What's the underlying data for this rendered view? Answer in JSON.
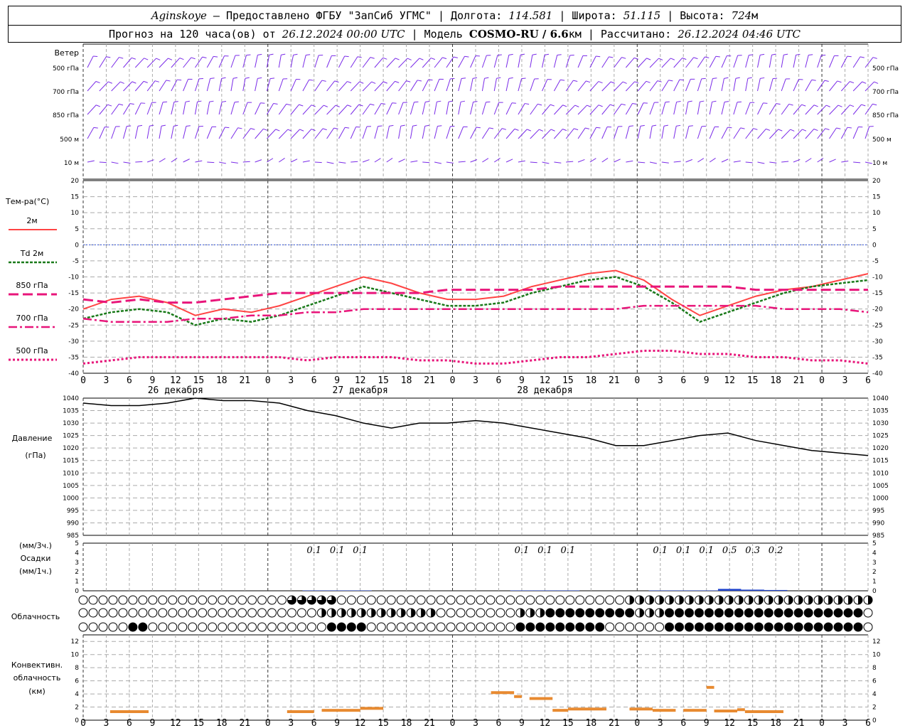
{
  "header": {
    "station": "Aginskoye",
    "provider": " – Предоставлено ФГБУ \"ЗапСиб УГМС\" | Долгота: ",
    "lon": "114.581",
    "lat_label": " | Широта: ",
    "lat": "51.115",
    "alt_label": " | Высота: ",
    "alt": "724",
    "alt_unit": "м",
    "forecast_label": "Прогноз на 120 часа(ов) от ",
    "forecast_start": "26.12.2024 00:00 UTC",
    "model_label": " | Модель ",
    "model": "COSMO-RU / 6.6",
    "model_unit": "км",
    "calc_label": " | Рассчитано: ",
    "calc_time": "26.12.2024 04:46 UTC"
  },
  "panels": {
    "wind": {
      "title": "Ветер",
      "levels": [
        "500 гПа",
        "700 гПа",
        "850 гПа",
        "500 м",
        "10 м"
      ]
    },
    "temperature": {
      "title": "Тем-ра(°C)",
      "legend": [
        {
          "label": "2м",
          "color": "#ff4444"
        },
        {
          "label": "Td 2м",
          "color": "#1a7a1a"
        },
        {
          "label": "850 гПа",
          "color": "#e8157a"
        },
        {
          "label": "700 гПа",
          "color": "#e8157a"
        },
        {
          "label": "500 гПа",
          "color": "#e8157a"
        }
      ]
    },
    "pressure": {
      "title": "Давление",
      "unit": "(гПа)"
    },
    "precip": {
      "unit_3h": "(мм/3ч.)",
      "title": "Осадки",
      "unit_1h": "(мм/1ч.)"
    },
    "clouds": {
      "title": "Облачность"
    },
    "convective": {
      "title_1": "Конвективн.",
      "title_2": "облачность",
      "unit": "(км)"
    }
  },
  "dates": [
    "26 декабря",
    "27 декабря",
    "28 декабря"
  ],
  "colors": {
    "wind": "#7a2be8",
    "t2m": "#ff4444",
    "td": "#1a7a1a",
    "upper": "#e8157a",
    "zero": "#3355dd",
    "precip": "#2244cc",
    "conv": "#e88a30"
  },
  "chart_data": {
    "type": "line",
    "x_hours": [
      0,
      3,
      6,
      9,
      12,
      15,
      18,
      21,
      24,
      27,
      30,
      33,
      36,
      39,
      42,
      45,
      48,
      51,
      54,
      57,
      60,
      63,
      66,
      69,
      72,
      75,
      78,
      81,
      84,
      87,
      90,
      93,
      96,
      99,
      102
    ],
    "x_tick_labels": [
      "0",
      "3",
      "6",
      "9",
      "12",
      "15",
      "18",
      "21",
      "0",
      "3",
      "6",
      "9",
      "12",
      "15",
      "18",
      "21",
      "0",
      "3",
      "6",
      "9",
      "12",
      "15",
      "18",
      "21",
      "0",
      "3",
      "6",
      "9",
      "12",
      "15",
      "18",
      "21",
      "0",
      "3",
      "6"
    ],
    "temperature": {
      "ylim": [
        -40,
        20
      ],
      "ticks": [
        20,
        15,
        10,
        5,
        0,
        -5,
        -10,
        -15,
        -20,
        -25,
        -30,
        -35,
        -40
      ],
      "series": [
        {
          "name": "2м",
          "values": [
            -20,
            -17,
            -16,
            -18,
            -22,
            -20,
            -21,
            -19,
            -16,
            -13,
            -10,
            -12,
            -15,
            -17,
            -17,
            -16,
            -13,
            -11,
            -9,
            -8,
            -11,
            -17,
            -22,
            -19,
            -16,
            -14,
            -13,
            -11,
            -9
          ]
        },
        {
          "name": "Td 2м",
          "values": [
            -23,
            -21,
            -20,
            -21,
            -25,
            -23,
            -24,
            -22,
            -19,
            -16,
            -13,
            -15,
            -17,
            -19,
            -19,
            -18,
            -15,
            -13,
            -11,
            -10,
            -13,
            -18,
            -24,
            -21,
            -18,
            -15,
            -13,
            -12,
            -11
          ]
        },
        {
          "name": "850 гПа",
          "values": [
            -17,
            -18,
            -17,
            -18,
            -18,
            -17,
            -16,
            -15,
            -15,
            -15,
            -15,
            -15,
            -15,
            -14,
            -14,
            -14,
            -14,
            -13,
            -13,
            -13,
            -13,
            -13,
            -13,
            -13,
            -14,
            -14,
            -14,
            -14,
            -14
          ]
        },
        {
          "name": "700 гПа",
          "values": [
            -23,
            -24,
            -24,
            -24,
            -23,
            -23,
            -22,
            -22,
            -21,
            -21,
            -20,
            -20,
            -20,
            -20,
            -20,
            -20,
            -20,
            -20,
            -20,
            -20,
            -19,
            -19,
            -19,
            -19,
            -19,
            -20,
            -20,
            -20,
            -21
          ]
        },
        {
          "name": "500 гПа",
          "values": [
            -37,
            -36,
            -35,
            -35,
            -35,
            -35,
            -35,
            -35,
            -36,
            -35,
            -35,
            -35,
            -36,
            -36,
            -37,
            -37,
            -36,
            -35,
            -35,
            -34,
            -33,
            -33,
            -34,
            -34,
            -35,
            -35,
            -36,
            -36,
            -37
          ]
        }
      ]
    },
    "pressure": {
      "ylim": [
        985,
        1040
      ],
      "ticks": [
        1040,
        1035,
        1030,
        1025,
        1020,
        1015,
        1010,
        1005,
        1000,
        995,
        990,
        985
      ],
      "values": [
        1038,
        1037,
        1037,
        1038,
        1040,
        1039,
        1039,
        1038,
        1035,
        1033,
        1030,
        1028,
        1030,
        1030,
        1031,
        1030,
        1028,
        1026,
        1024,
        1021,
        1021,
        1023,
        1025,
        1026,
        1023,
        1021,
        1019,
        1018,
        1017
      ]
    },
    "precipitation": {
      "ylim": [
        0,
        5
      ],
      "ticks": [
        5,
        4,
        3,
        2,
        1,
        0
      ],
      "totals_3h": [
        {
          "hour": 30,
          "value": "0.1"
        },
        {
          "hour": 33,
          "value": "0.1"
        },
        {
          "hour": 36,
          "value": "0.1"
        },
        {
          "hour": 57,
          "value": "0.1"
        },
        {
          "hour": 60,
          "value": "0.1"
        },
        {
          "hour": 63,
          "value": "0.1"
        },
        {
          "hour": 75,
          "value": "0.1"
        },
        {
          "hour": 78,
          "value": "0.1"
        },
        {
          "hour": 81,
          "value": "0.1"
        },
        {
          "hour": 84,
          "value": "0.5"
        },
        {
          "hour": 87,
          "value": "0.3"
        },
        {
          "hour": 90,
          "value": "0.2"
        }
      ]
    },
    "convective": {
      "ylim": [
        0,
        13
      ],
      "ticks": [
        12,
        10,
        8,
        6,
        4,
        2,
        0
      ],
      "segments": [
        {
          "from": 3.5,
          "to": 8.5,
          "value": 1.3
        },
        {
          "from": 26.5,
          "to": 30,
          "value": 1.3
        },
        {
          "from": 31,
          "to": 36,
          "value": 1.5
        },
        {
          "from": 36,
          "to": 39,
          "value": 1.8
        },
        {
          "from": 53,
          "to": 56,
          "value": 4.2
        },
        {
          "from": 56,
          "to": 57,
          "value": 3.6
        },
        {
          "from": 58,
          "to": 61,
          "value": 3.3
        },
        {
          "from": 61,
          "to": 63,
          "value": 1.5
        },
        {
          "from": 63,
          "to": 68,
          "value": 1.7
        },
        {
          "from": 71,
          "to": 74,
          "value": 1.7
        },
        {
          "from": 74,
          "to": 77,
          "value": 1.5
        },
        {
          "from": 78,
          "to": 81,
          "value": 1.5
        },
        {
          "from": 81,
          "to": 82,
          "value": 5.0
        },
        {
          "from": 82,
          "to": 85,
          "value": 1.4
        },
        {
          "from": 85,
          "to": 86,
          "value": 1.6
        },
        {
          "from": 86,
          "to": 91,
          "value": 1.3
        }
      ]
    }
  }
}
